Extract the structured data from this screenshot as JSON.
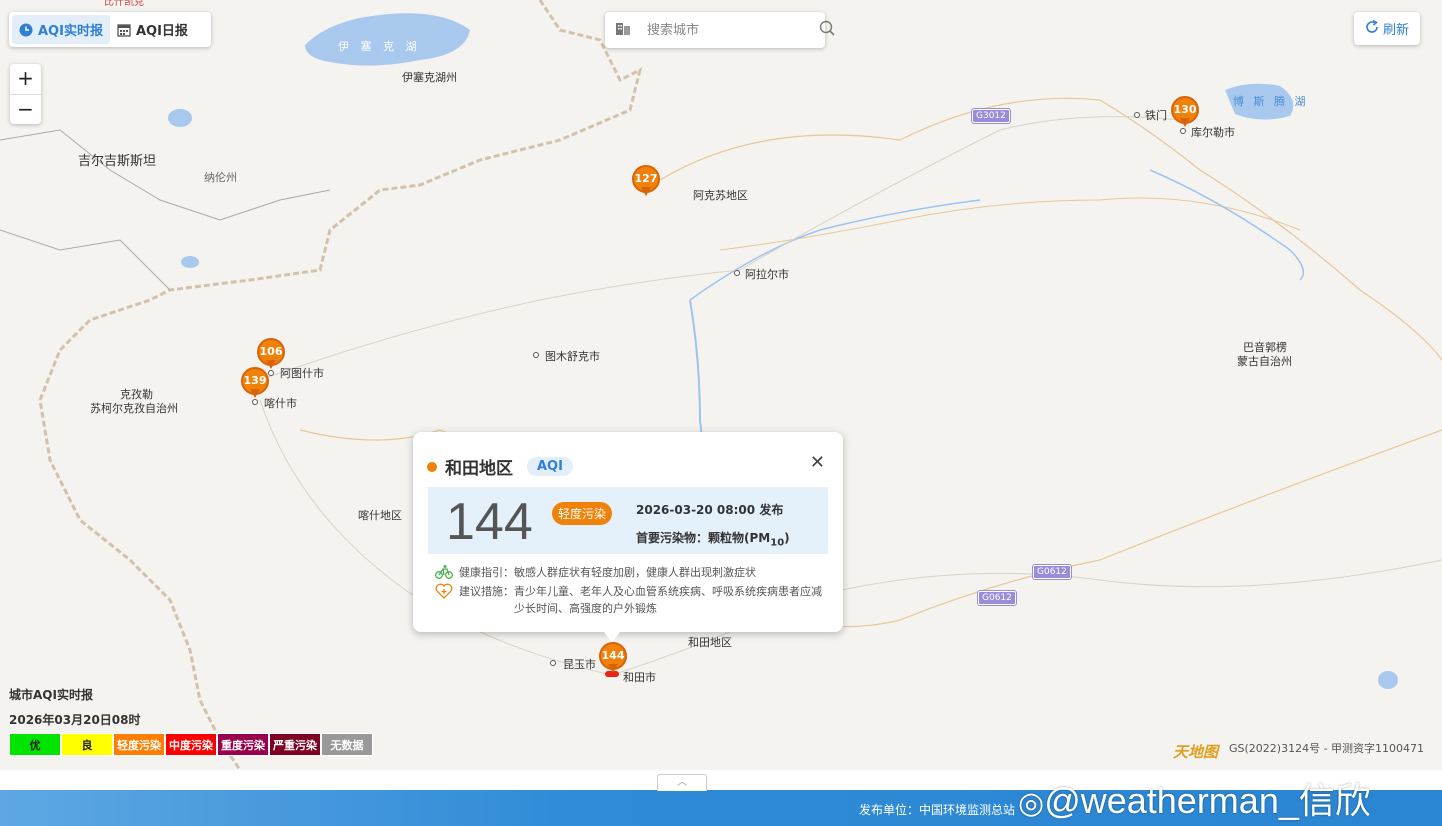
{
  "tabs": [
    {
      "label": "AQI实时报",
      "icon": "clock-icon",
      "active": true
    },
    {
      "label": "AQI日报",
      "icon": "calendar-icon",
      "active": false
    }
  ],
  "search": {
    "placeholder": "搜索城市"
  },
  "refresh": {
    "label": "刷新"
  },
  "zoom": {
    "in": "+",
    "out": "−"
  },
  "map": {
    "top_clip": "比什凯克",
    "labels": {
      "lake_yisaike": "伊 塞 克 湖",
      "yisaike_zhou": "伊塞克湖州",
      "kyrgyzstan": "吉尔吉斯斯坦",
      "naren": "纳伦州",
      "akesu_region": "阿克苏地区",
      "alaer": "阿拉尔市",
      "tumushuke": "图木舒克市",
      "atushi": "阿图什市",
      "kashi": "喀什市",
      "kezile": "克孜勒",
      "kezile2": "苏柯尔克孜自治州",
      "kashi_region": "喀什地区",
      "tiemen": "铁门",
      "kuerle": "库尔勒市",
      "bosten": "博 斯 腾 湖",
      "bayin": "巴音郭楞",
      "bayin2": "蒙古自治州",
      "hetian_region": "和田地区",
      "kunyu": "昆玉市",
      "hetian_city": "和田市"
    },
    "roads": [
      "G3012",
      "G0612",
      "G0612"
    ],
    "markers": [
      {
        "value": "127",
        "city": "阿克苏"
      },
      {
        "value": "130",
        "city": "库尔勒"
      },
      {
        "value": "106",
        "city": "阿图什"
      },
      {
        "value": "139",
        "city": "喀什"
      },
      {
        "value": "144",
        "city": "和田"
      }
    ]
  },
  "popup": {
    "title": "和田地区",
    "tag": "AQI",
    "aqi": "144",
    "level": "轻度污染",
    "level_color": "#f0820a",
    "time": "2026-03-20 08:00",
    "time_suffix": "发布",
    "pollutant_label": "首要污染物：颗粒物(PM",
    "pollutant_sub": "10",
    "pollutant_end": ")",
    "health_label": "健康指引：",
    "health_text": "敏感人群症状有轻度加剧，健康人群出现刺激症状",
    "advice_label": "建议措施：",
    "advice_text": "青少年儿童、老年人及心血管系统疾病、呼吸系统疾病患者应减少长时间、高强度的户外锻炼"
  },
  "legend": {
    "title": "城市AQI实时报",
    "date": "2026年03月20日08时",
    "levels": [
      {
        "label": "优",
        "color": "#00e400"
      },
      {
        "label": "良",
        "color": "#ffff00"
      },
      {
        "label": "轻度污染",
        "color": "#ff7e00"
      },
      {
        "label": "中度污染",
        "color": "#ff0000"
      },
      {
        "label": "重度污染",
        "color": "#99004c"
      },
      {
        "label": "严重污染",
        "color": "#7e0023"
      },
      {
        "label": "无数据",
        "color": "#999999"
      }
    ]
  },
  "credits": {
    "logo": "天地图",
    "gs": "GS(2022)3124号 - 甲测资字1100471"
  },
  "footer": {
    "publisher": "发布单位：中国环境监测总站",
    "watermark": "@weatherman_信欣"
  }
}
